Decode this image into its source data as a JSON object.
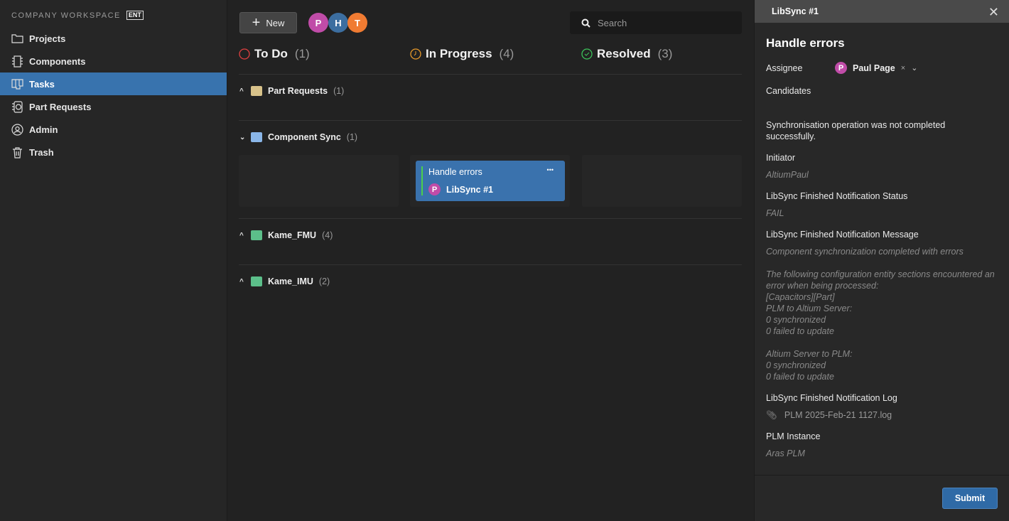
{
  "sidebar": {
    "workspace": "COMPANY WORKSPACE",
    "badge": "ENT",
    "items": [
      {
        "label": "Projects"
      },
      {
        "label": "Components"
      },
      {
        "label": "Tasks"
      },
      {
        "label": "Part Requests"
      },
      {
        "label": "Admin"
      },
      {
        "label": "Trash"
      }
    ]
  },
  "toolbar": {
    "new_label": "New",
    "avatars": [
      "P",
      "H",
      "T"
    ],
    "search_placeholder": "Search"
  },
  "columns": [
    {
      "label": "To Do",
      "count": "(1)"
    },
    {
      "label": "In Progress",
      "count": "(4)"
    },
    {
      "label": "Resolved",
      "count": "(3)"
    }
  ],
  "groups": [
    {
      "label": "Part Requests",
      "count": "(1)"
    },
    {
      "label": "Component Sync",
      "count": "(1)"
    },
    {
      "label": "Kame_FMU",
      "count": "(4)"
    },
    {
      "label": "Kame_IMU",
      "count": "(2)"
    }
  ],
  "card": {
    "title": "Handle errors",
    "avatar": "P",
    "subtitle": "LibSync #1",
    "menu": "•••"
  },
  "panel": {
    "header": "LibSync #1",
    "title": "Handle errors",
    "assignee_label": "Assignee",
    "assignee_avatar": "P",
    "assignee": "Paul Page",
    "candidates_label": "Candidates",
    "message": "Synchronisation operation was not completed successfully.",
    "fields": [
      {
        "label": "Initiator",
        "value": "AltiumPaul"
      },
      {
        "label": "LibSync Finished Notification Status",
        "value": "FAIL"
      },
      {
        "label": "LibSync Finished Notification Message",
        "value": "Component synchronization completed with errors"
      }
    ],
    "details": [
      "The following configuration entity sections encountered an error when being processed:",
      "[Capacitors][Part]",
      "PLM to Altium Server:",
      "0 synchronized",
      "0 failed to update",
      "",
      "Altium Server to PLM:",
      "0 synchronized",
      "0 failed to update"
    ],
    "log_label": "LibSync Finished Notification Log",
    "log_file": "PLM 2025-Feb-21 1127.log",
    "plm_label": "PLM Instance",
    "plm_value": "Aras PLM",
    "submit": "Submit"
  },
  "colors": {
    "accent": "#3873ae",
    "todo": "#e04040",
    "progress": "#e89a2a",
    "resolved": "#3cc35a",
    "avatar_p": "#c04ca8",
    "avatar_h": "#3c6ea0",
    "avatar_t": "#f07b32"
  }
}
